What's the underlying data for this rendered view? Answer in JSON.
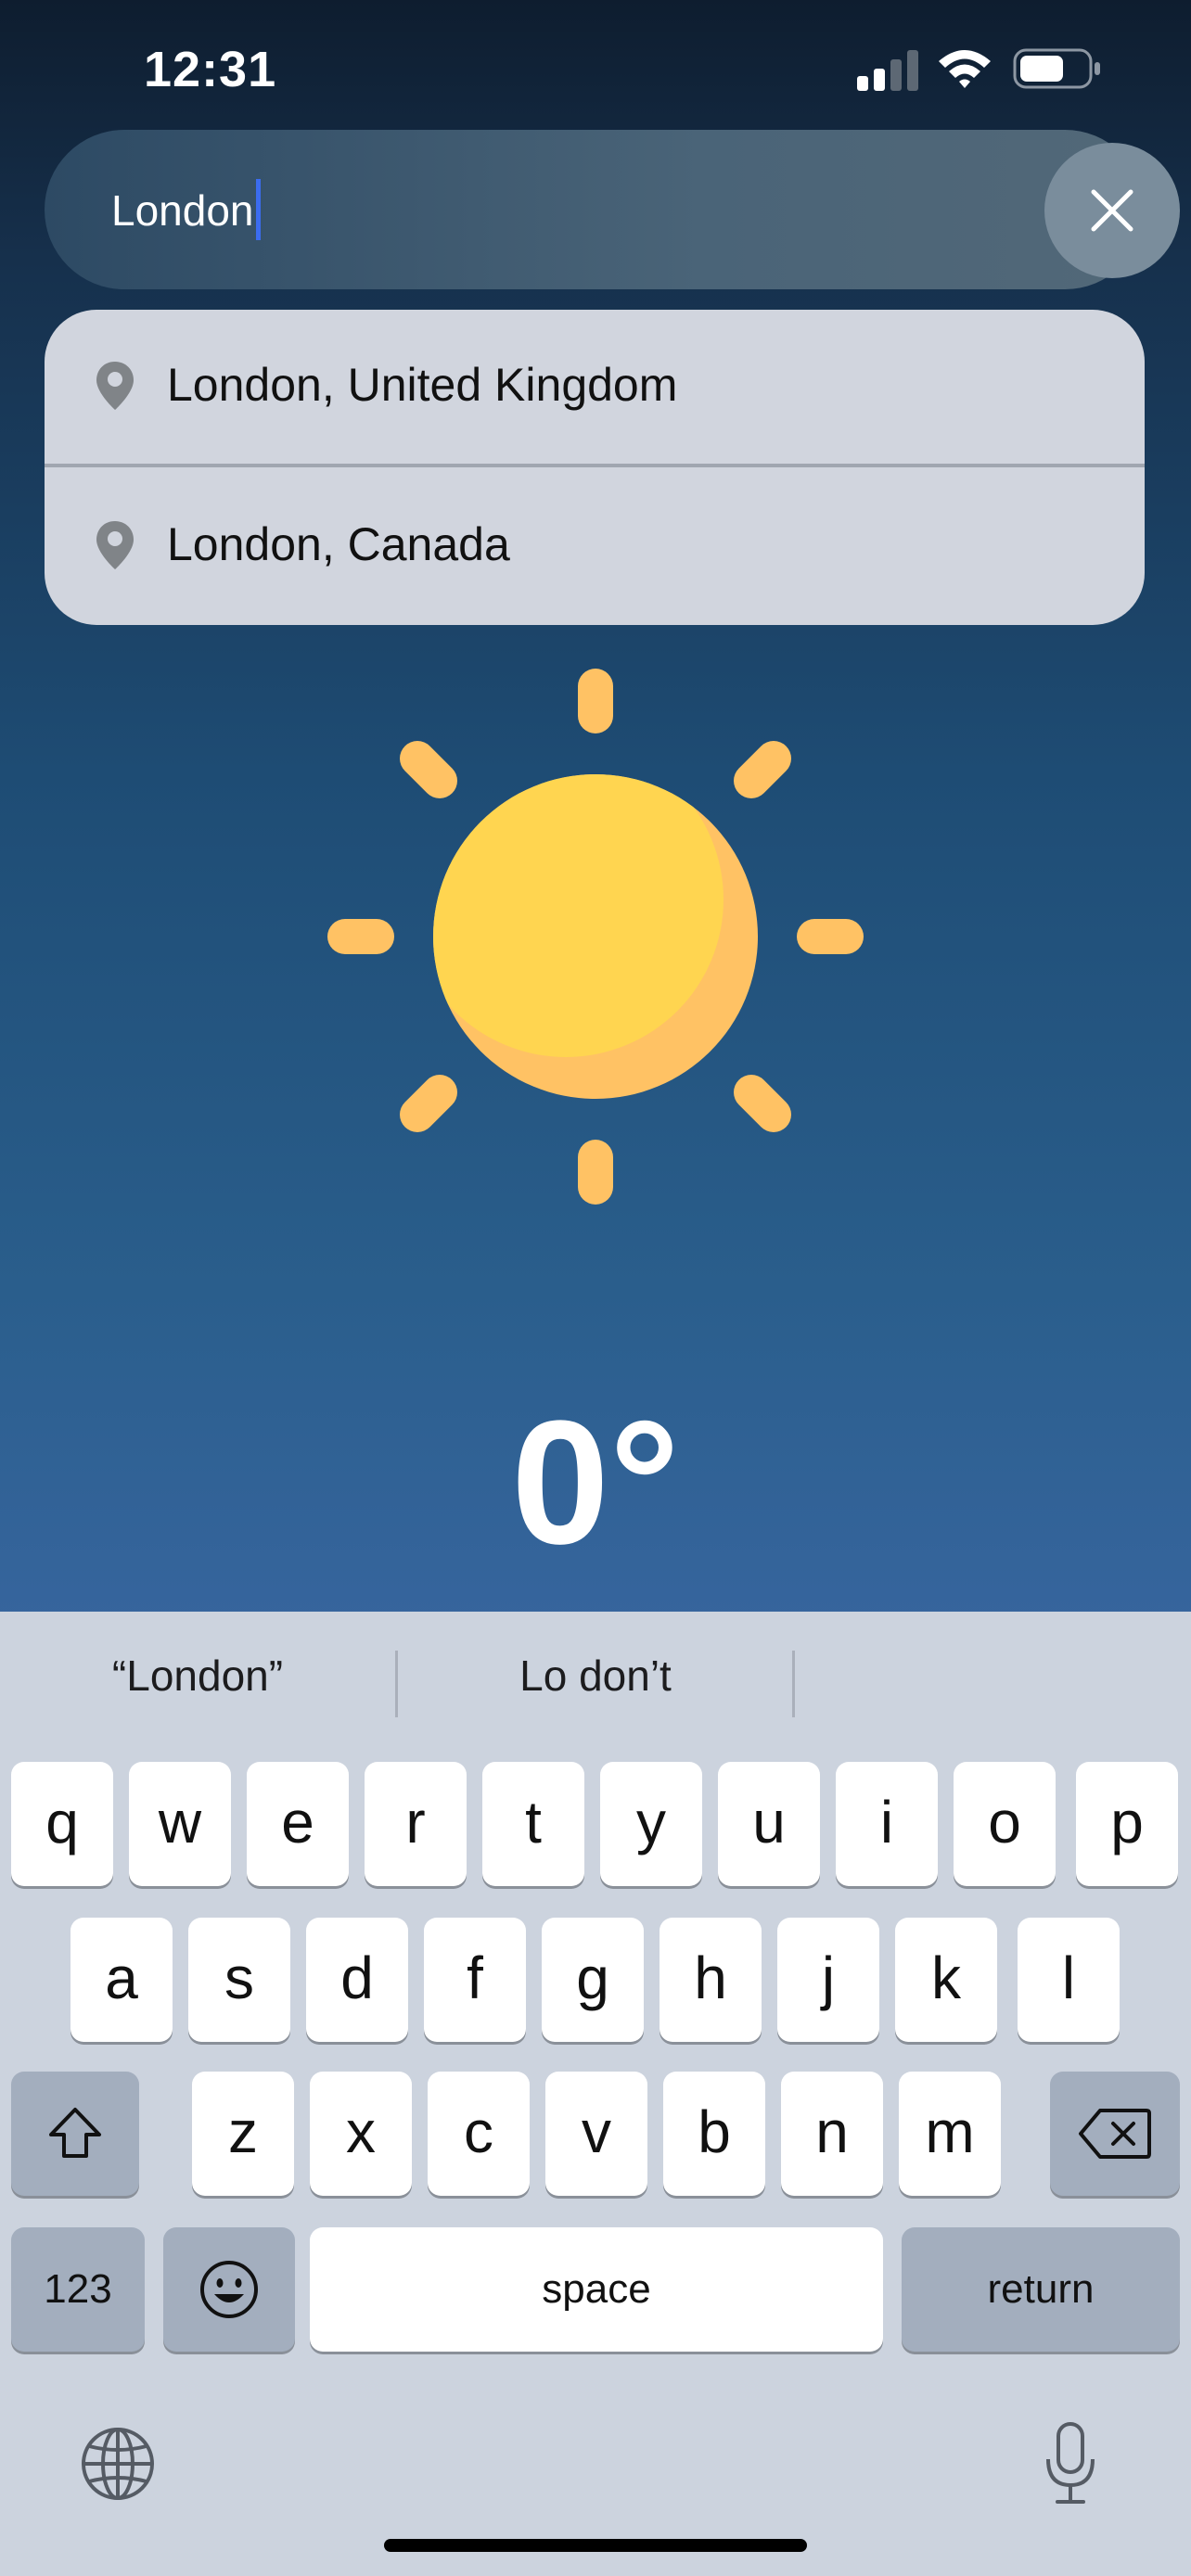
{
  "status_bar": {
    "time": "12:31"
  },
  "search": {
    "value": "London"
  },
  "suggestions": [
    {
      "label": "London, United Kingdom"
    },
    {
      "label": "London, Canada"
    }
  ],
  "weather": {
    "temperature": "0°"
  },
  "keyboard": {
    "predictions": [
      "“London”",
      "Lo don’t",
      ""
    ],
    "row1": [
      "q",
      "w",
      "e",
      "r",
      "t",
      "y",
      "u",
      "i",
      "o",
      "p"
    ],
    "row2": [
      "a",
      "s",
      "d",
      "f",
      "g",
      "h",
      "j",
      "k",
      "l"
    ],
    "row3": [
      "z",
      "x",
      "c",
      "v",
      "b",
      "n",
      "m"
    ],
    "numbers_label": "123",
    "space_label": "space",
    "return_label": "return"
  },
  "colors": {
    "sun": "#ffd550",
    "sun_shade": "#ffc264",
    "rays": "#ffc264",
    "caret": "#3b6cf0"
  }
}
